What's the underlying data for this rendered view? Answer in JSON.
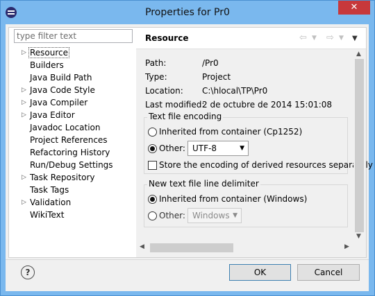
{
  "window": {
    "title": "Properties for Pr0",
    "close_label": "✕"
  },
  "filter": {
    "placeholder": "type filter text"
  },
  "tree": {
    "items": [
      {
        "label": "Resource",
        "expandable": true,
        "selected": true
      },
      {
        "label": "Builders",
        "expandable": false
      },
      {
        "label": "Java Build Path",
        "expandable": false
      },
      {
        "label": "Java Code Style",
        "expandable": true
      },
      {
        "label": "Java Compiler",
        "expandable": true
      },
      {
        "label": "Java Editor",
        "expandable": true
      },
      {
        "label": "Javadoc Location",
        "expandable": false
      },
      {
        "label": "Project References",
        "expandable": false
      },
      {
        "label": "Refactoring History",
        "expandable": false
      },
      {
        "label": "Run/Debug Settings",
        "expandable": false
      },
      {
        "label": "Task Repository",
        "expandable": true
      },
      {
        "label": "Task Tags",
        "expandable": false
      },
      {
        "label": "Validation",
        "expandable": true
      },
      {
        "label": "WikiText",
        "expandable": false
      }
    ]
  },
  "page": {
    "title": "Resource",
    "info": [
      {
        "key": "Path:",
        "value": "/Pr0"
      },
      {
        "key": "Type:",
        "value": "Project"
      },
      {
        "key": "Location:",
        "value": "C:\\hlocal\\TP\\Pr0"
      },
      {
        "key": "Last modified:",
        "value": "2 de octubre de 2014 15:01:08"
      }
    ],
    "encoding": {
      "legend": "Text file encoding",
      "inherited_label": "Inherited from container (Cp1252)",
      "other_label": "Other:",
      "other_value": "UTF-8",
      "store_label": "Store the encoding of derived resources separately"
    },
    "delimiter": {
      "legend": "New text file line delimiter",
      "inherited_label": "Inherited from container (Windows)",
      "other_label": "Other:",
      "other_value": "Windows"
    }
  },
  "buttons": {
    "help": "?",
    "ok": "OK",
    "cancel": "Cancel"
  },
  "colors": {
    "titlebar": "#7ab8ee",
    "close": "#c7383b"
  }
}
